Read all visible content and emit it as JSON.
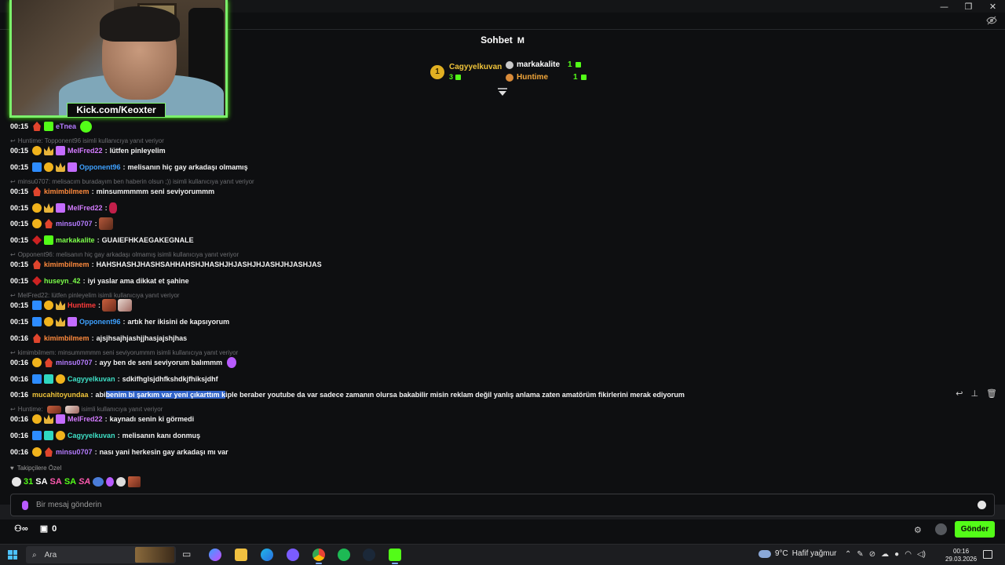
{
  "window": {
    "controls": {
      "minimize": "—",
      "maximize": "❐",
      "close": "✕"
    }
  },
  "chat": {
    "title": "Sohbet",
    "title_suffix": "M"
  },
  "leaderboard": {
    "first": {
      "rank": "1",
      "name": "Cagyyelkuvan",
      "count": "3"
    },
    "second": {
      "name": "markakalite",
      "count": "1"
    },
    "third": {
      "name": "Huntime",
      "count": "1"
    }
  },
  "webcam": {
    "label": "Kick.com/Keoxter"
  },
  "messages": [
    {
      "time": "00:15",
      "user": "eTnea",
      "color": "#b57cff",
      "text": ""
    },
    {
      "time": "00:15",
      "user": "MelFred22",
      "color": "#d47cff",
      "text": "lütfen pinleyelim"
    },
    {
      "time": "00:15",
      "user": "Opponent96",
      "color": "#3ea1ff",
      "text": "melisanın hiç gay arkadaşı olmamış"
    },
    {
      "time": "00:15",
      "user": "kimimbilmem",
      "color": "#ff8a3d",
      "text": "minsummmmm seni seviyorummm"
    },
    {
      "time": "00:15",
      "user": "MelFred22",
      "color": "#d47cff",
      "text": ""
    },
    {
      "time": "00:15",
      "user": "minsu0707",
      "color": "#b57cff",
      "text": ""
    },
    {
      "time": "00:15",
      "user": "markakalite",
      "color": "#7cff4a",
      "text": "GUAIEFHKAEGAKEGNALE"
    },
    {
      "time": "00:15",
      "user": "kimimbilmem",
      "color": "#ff8a3d",
      "text": "HAHSHASHJHASHSAHHAHSHJHASHJHJASHJHJASHJHJASHJAS"
    },
    {
      "time": "00:15",
      "user": "huseyn_42",
      "color": "#7cff4a",
      "text": "iyi yaslar ama dikkat et şahine"
    },
    {
      "time": "00:15",
      "user": "Huntime",
      "color": "#ff3b3b",
      "text": ""
    },
    {
      "time": "00:15",
      "user": "Opponent96",
      "color": "#3ea1ff",
      "text": "artık her ikisini de kapsıyorum"
    },
    {
      "time": "00:16",
      "user": "kimimbilmem",
      "color": "#ff8a3d",
      "text": "ajsjhsajhjashjjhasjajshjhas"
    },
    {
      "time": "00:16",
      "user": "minsu0707",
      "color": "#b57cff",
      "text": "ayy ben de seni seviyorum balımmm"
    },
    {
      "time": "00:16",
      "user": "Cagyyelkuvan",
      "color": "#3ee0c6",
      "text": "sdkifhglsjdhfkshdkjfhiksjdhf"
    },
    {
      "time": "00:16",
      "user": "mucahitoyundaa",
      "color": "#f0c43a",
      "text_before": "abi ",
      "text_highlight": "benim bi şarkım var yeni çıkarttım k",
      "text_after": "iple beraber youtube da var sadece zamanın olursa bakabilir misin reklam değil yanlış anlama zaten amatörüm fikirlerini merak ediyorum"
    },
    {
      "time": "00:16",
      "user": "MelFred22",
      "color": "#d47cff",
      "text": "kaynadı senin ki görmedi"
    },
    {
      "time": "00:16",
      "user": "Cagyyelkuvan",
      "color": "#3ee0c6",
      "text": "melisanın kanı donmuş"
    },
    {
      "time": "00:16",
      "user": "minsu0707",
      "color": "#b57cff",
      "text": "nası yani herkesin gay arkadaşı mı var"
    }
  ],
  "replies": [
    "Huntime: Topponent96 isimli kullanıcıya yanıt veriyor",
    "minsu0707: melisacım buradayım ben haberin olsun ;)) isimli kullanıcıya yanıt veriyor",
    "Opponent96: melisanın hiç gay arkadaşı olmamış isimli kullanıcıya yanıt veriyor",
    "MelFred22: lütfen pinleyelim isimli kullanıcıya yanıt veriyor",
    "kimimbilmem: minsummmmm seni seviyorummm isimli kullanıcıya yanıt veriyor",
    "Huntime:",
    "isimli kullanıcıya yanıt veriyor"
  ],
  "followers_only": "Takipçilere Özel",
  "emote_bar": [
    "31",
    "SA",
    "SA",
    "SA",
    "SA"
  ],
  "input": {
    "placeholder": "Bir mesaj gönderin"
  },
  "bottom": {
    "viewer_count": "0",
    "send_label": "Gönder"
  },
  "taskbar": {
    "search_label": "Ara",
    "weather_temp": "9°C",
    "weather_text": "Hafif yağmur",
    "time": "00:16",
    "date": "29.03.2026"
  },
  "colors": {
    "accent": "#53fc18",
    "highlight": "#2f62c8"
  }
}
